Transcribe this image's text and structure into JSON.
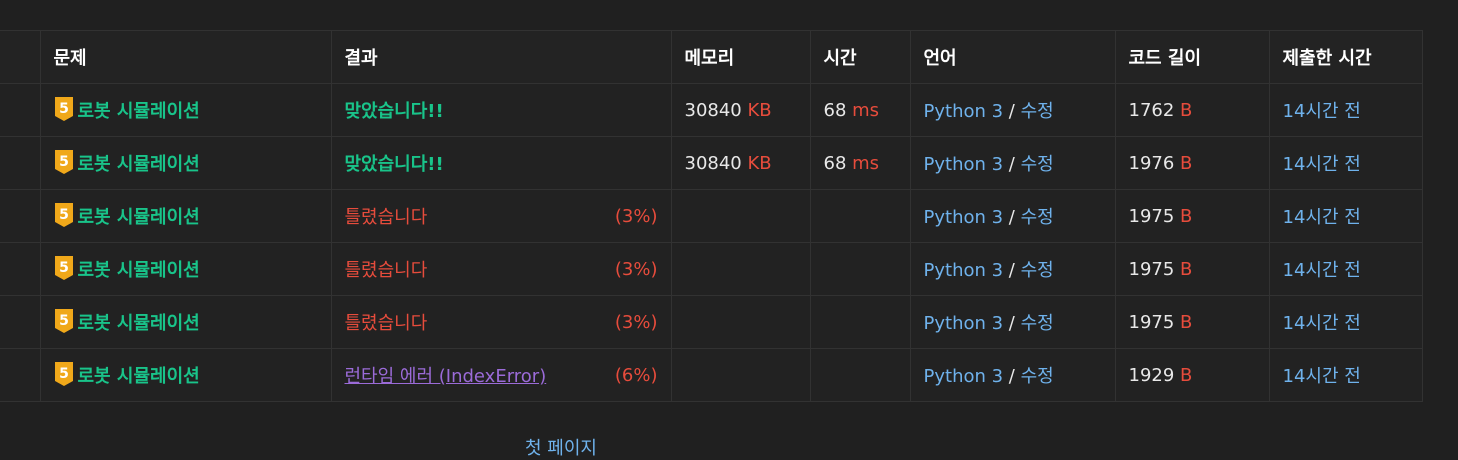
{
  "headers": [
    "문제",
    "결과",
    "메모리",
    "시간",
    "언어",
    "코드 길이",
    "제출한 시간"
  ],
  "colors": {
    "accepted": "#19c48a",
    "wrong": "#e74c3c",
    "runtime_error": "#9b6bd8",
    "link_blue": "#6fb2ec",
    "tier_gold": "#f0a81a"
  },
  "rows": [
    {
      "tier": "5",
      "problem": "로봇 시뮬레이션",
      "result": "맞았습니다!!",
      "result_type": "ac",
      "percent": "",
      "memory": "30840",
      "memory_unit": "KB",
      "time": "68",
      "time_unit": "ms",
      "language": "Python 3",
      "sep": " / ",
      "edit": "수정",
      "code_length": "1762",
      "code_unit": "B",
      "submitted": "14시간 전"
    },
    {
      "tier": "5",
      "problem": "로봇 시뮬레이션",
      "result": "맞았습니다!!",
      "result_type": "ac",
      "percent": "",
      "memory": "30840",
      "memory_unit": "KB",
      "time": "68",
      "time_unit": "ms",
      "language": "Python 3",
      "sep": " / ",
      "edit": "수정",
      "code_length": "1976",
      "code_unit": "B",
      "submitted": "14시간 전"
    },
    {
      "tier": "5",
      "problem": "로봇 시뮬레이션",
      "result": "틀렸습니다",
      "result_type": "wa",
      "percent": "(3%)",
      "memory": "",
      "memory_unit": "",
      "time": "",
      "time_unit": "",
      "language": "Python 3",
      "sep": " / ",
      "edit": "수정",
      "code_length": "1975",
      "code_unit": "B",
      "submitted": "14시간 전"
    },
    {
      "tier": "5",
      "problem": "로봇 시뮬레이션",
      "result": "틀렸습니다",
      "result_type": "wa",
      "percent": "(3%)",
      "memory": "",
      "memory_unit": "",
      "time": "",
      "time_unit": "",
      "language": "Python 3",
      "sep": " / ",
      "edit": "수정",
      "code_length": "1975",
      "code_unit": "B",
      "submitted": "14시간 전"
    },
    {
      "tier": "5",
      "problem": "로봇 시뮬레이션",
      "result": "틀렸습니다",
      "result_type": "wa",
      "percent": "(3%)",
      "memory": "",
      "memory_unit": "",
      "time": "",
      "time_unit": "",
      "language": "Python 3",
      "sep": " / ",
      "edit": "수정",
      "code_length": "1975",
      "code_unit": "B",
      "submitted": "14시간 전"
    },
    {
      "tier": "5",
      "problem": "로봇 시뮬레이션",
      "result": "런타임 에러 (IndexError)",
      "result_type": "re",
      "percent": "(6%)",
      "memory": "",
      "memory_unit": "",
      "time": "",
      "time_unit": "",
      "language": "Python 3",
      "sep": " / ",
      "edit": "수정",
      "code_length": "1929",
      "code_unit": "B",
      "submitted": "14시간 전"
    }
  ],
  "footer": {
    "next_page": "첫 페이지"
  }
}
